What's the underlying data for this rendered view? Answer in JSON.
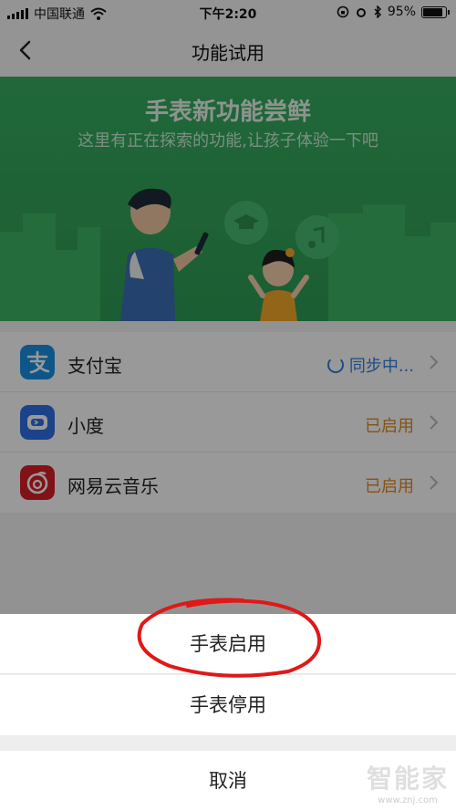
{
  "status_bar": {
    "carrier": "中国联通",
    "time": "下午2:20",
    "battery": "95%"
  },
  "nav": {
    "title": "功能试用"
  },
  "banner": {
    "title": "手表新功能尝鲜",
    "subtitle": "这里有正在探索的功能,让孩子体验一下吧"
  },
  "apps": [
    {
      "name": "支付宝",
      "status": "同步中...",
      "icon": "alipay-icon",
      "color": "#1a8fe3"
    },
    {
      "name": "小度",
      "status": "已启用",
      "icon": "xiaodu-icon",
      "color": "#2f6fe6"
    },
    {
      "name": "网易云音乐",
      "status": "已启用",
      "icon": "netease-music-icon",
      "color": "#d81e27"
    }
  ],
  "sheet": {
    "enable": "手表启用",
    "disable": "手表停用",
    "cancel": "取消"
  },
  "watermark": {
    "logo": "智能家",
    "url": "www.znj.com"
  },
  "colors": {
    "banner_green": "#36ad60",
    "sync_blue": "#2f7fe0",
    "enabled_orange": "#e08a1e",
    "annotation_red": "#e01818"
  }
}
